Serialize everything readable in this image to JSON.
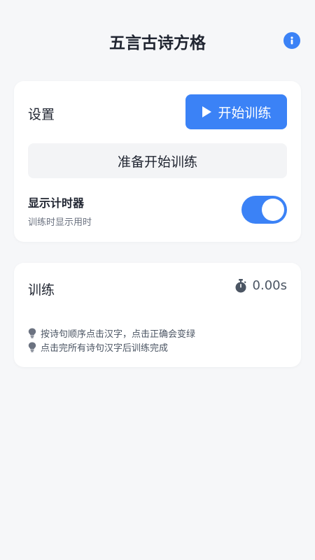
{
  "header": {
    "title": "五言古诗方格",
    "info_icon": "info-icon"
  },
  "settings": {
    "label": "设置",
    "start_button": "开始训练",
    "status": "准备开始训练",
    "timer_toggle": {
      "title": "显示计时器",
      "subtitle": "训练时显示用时",
      "enabled": true
    }
  },
  "training": {
    "label": "训练",
    "timer_value": "0.00s",
    "tips": [
      "按诗句顺序点击汉字，点击正确会变绿",
      "点击完所有诗句汉字后训练完成"
    ]
  },
  "colors": {
    "accent": "#3b82f6",
    "background": "#f6f7f9",
    "card": "#ffffff"
  }
}
